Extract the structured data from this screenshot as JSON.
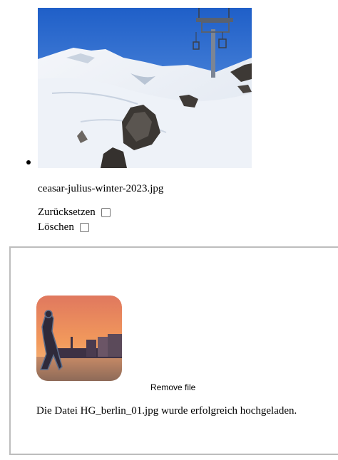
{
  "existing_file": {
    "name": "ceasar-julius-winter-2023.jpg",
    "reset_label": "Zurücksetzen",
    "delete_label": "Löschen"
  },
  "upload": {
    "remove_label": "Remove file",
    "success_message": "Die Datei HG_berlin_01.jpg wurde erfolgreich hochgeladen."
  }
}
